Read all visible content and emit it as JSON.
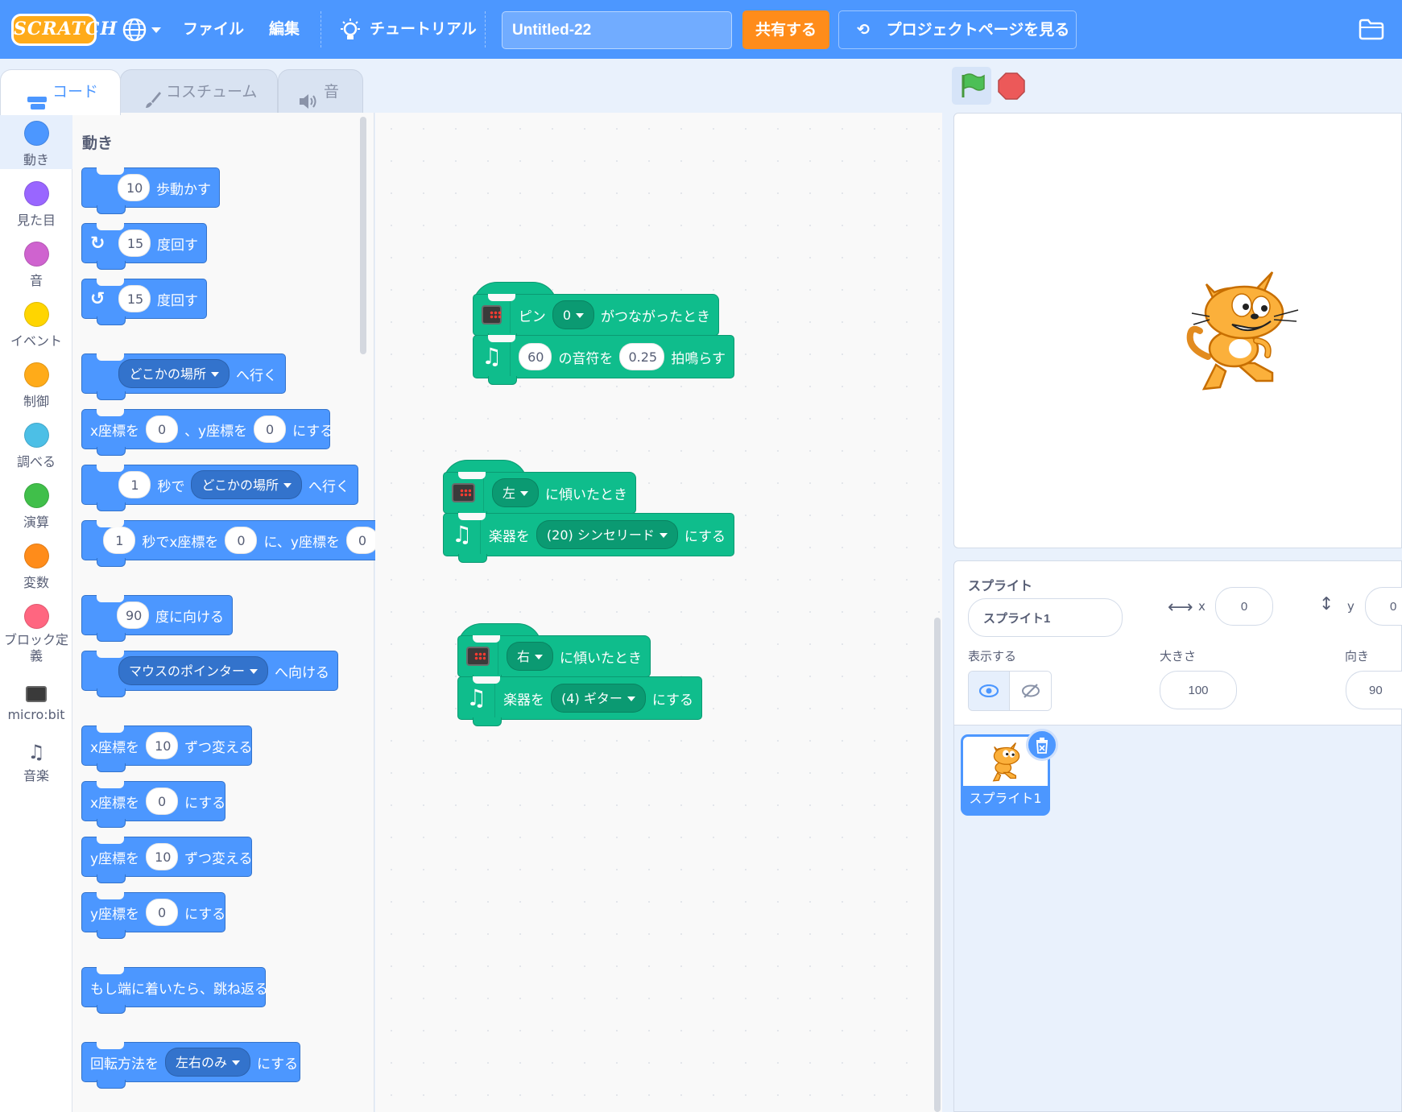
{
  "menubar": {
    "logo": "SCRATCH",
    "file": "ファイル",
    "edit": "編集",
    "tutorial": "チュートリアル",
    "project_title": "Untitled-22",
    "share": "共有する",
    "see_project_page": "プロジェクトページを見る"
  },
  "tabs": {
    "code": "コード",
    "costumes": "コスチューム",
    "sounds": "音"
  },
  "categories": [
    {
      "label": "動き",
      "color": "#4c97ff"
    },
    {
      "label": "見た目",
      "color": "#9966ff"
    },
    {
      "label": "音",
      "color": "#cf63cf"
    },
    {
      "label": "イベント",
      "color": "#ffd500"
    },
    {
      "label": "制御",
      "color": "#ffab19"
    },
    {
      "label": "調べる",
      "color": "#4cbfe6"
    },
    {
      "label": "演算",
      "color": "#40bf4a"
    },
    {
      "label": "変数",
      "color": "#ff8c1a"
    },
    {
      "label": "ブロック定義",
      "color": "#ff6680"
    },
    {
      "label": "micro:bit",
      "color": "#3a3a3a"
    },
    {
      "label": "音楽",
      "color": "#ffffff"
    }
  ],
  "flyout": {
    "title": "動き",
    "move": {
      "value": "10",
      "text": "歩動かす"
    },
    "turn_right": {
      "value": "15",
      "text": "度回す"
    },
    "turn_left": {
      "value": "15",
      "text": "度回す"
    },
    "goto": {
      "menu": "どこかの場所",
      "text": "へ行く"
    },
    "goto_xy": {
      "t1": "x座標を",
      "x": "0",
      "t2": "、y座標を",
      "y": "0",
      "t3": "にする"
    },
    "glide": {
      "secs": "1",
      "t1": "秒で",
      "menu": "どこかの場所",
      "t2": "へ行く"
    },
    "glide_xy": {
      "secs": "1",
      "t1": "秒でx座標を",
      "x": "0",
      "t2": "に、y座標を",
      "y": "0"
    },
    "point_dir": {
      "value": "90",
      "text": "度に向ける"
    },
    "point_towards": {
      "menu": "マウスのポインター",
      "text": "へ向ける"
    },
    "change_x": {
      "t1": "x座標を",
      "value": "10",
      "t2": "ずつ変える"
    },
    "set_x": {
      "t1": "x座標を",
      "value": "0",
      "t2": "にする"
    },
    "change_y": {
      "t1": "y座標を",
      "value": "10",
      "t2": "ずつ変える"
    },
    "set_y": {
      "t1": "y座標を",
      "value": "0",
      "t2": "にする"
    },
    "bounce": "もし端に着いたら、跳ね返る",
    "rotation": {
      "t1": "回転方法を",
      "menu": "左右のみ",
      "t2": "にする"
    }
  },
  "scripts": {
    "s1": {
      "hat": {
        "t1": "ピン",
        "menu": "0",
        "t2": "がつながったとき"
      },
      "cmd": {
        "note": "60",
        "t1": "の音符を",
        "beats": "0.25",
        "t2": "拍鳴らす"
      }
    },
    "s2": {
      "hat": {
        "menu": "左",
        "t": "に傾いたとき"
      },
      "cmd": {
        "t1": "楽器を",
        "menu": "(20) シンセリード",
        "t2": "にする"
      }
    },
    "s3": {
      "hat": {
        "menu": "右",
        "t": "に傾いたとき"
      },
      "cmd": {
        "t1": "楽器を",
        "menu": "(4) ギター",
        "t2": "にする"
      }
    }
  },
  "sprite_info": {
    "label": "スプライト",
    "name": "スプライト1",
    "x_label": "x",
    "x": "0",
    "y_label": "y",
    "y": "0",
    "show_label": "表示する",
    "size_label": "大きさ",
    "size": "100",
    "direction_label": "向き",
    "direction": "90"
  },
  "sprite_tile": {
    "name": "スプライト1"
  }
}
